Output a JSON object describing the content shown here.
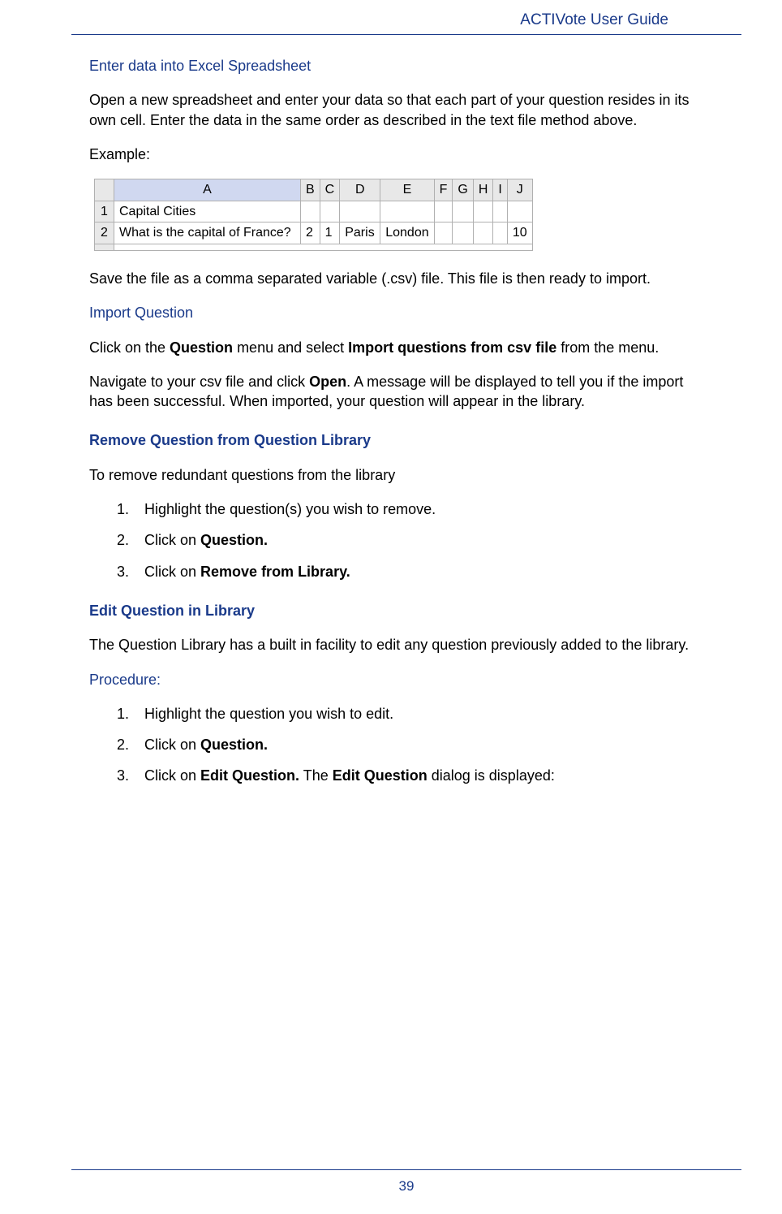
{
  "header": {
    "title": "ACTIVote User Guide"
  },
  "section1": {
    "heading": "Enter data into Excel Spreadsheet",
    "p1": "Open a new spreadsheet and enter your data so that each part of your question resides in its own cell. Enter the data in the same order as described in the text file method above.",
    "p2": "Example:"
  },
  "spreadsheet": {
    "cols": [
      "A",
      "B",
      "C",
      "D",
      "E",
      "F",
      "G",
      "H",
      "I",
      "J"
    ],
    "rows": [
      {
        "num": "1",
        "cells": [
          "Capital Cities",
          "",
          "",
          "",
          "",
          "",
          "",
          "",
          "",
          ""
        ]
      },
      {
        "num": "2",
        "cells": [
          "What is the capital of France?",
          "2",
          "1",
          "Paris",
          "London",
          "",
          "",
          "",
          "",
          "10"
        ]
      }
    ]
  },
  "section1b": {
    "p1": "Save the file as a comma separated variable (.csv) file. This file is then ready to import."
  },
  "section2": {
    "heading": "Import Question",
    "p1_pre": "Click on the ",
    "p1_b1": "Question",
    "p1_mid": " menu and select ",
    "p1_b2": "Import questions from csv file",
    "p1_post": " from the menu.",
    "p2_pre": "Navigate to your csv file and click ",
    "p2_b1": "Open",
    "p2_post": ". A message will be displayed to tell you if the import has been successful. When imported, your question will appear in the library."
  },
  "section3": {
    "heading": "Remove Question from Question Library",
    "p1": "To remove redundant questions from the library",
    "items": {
      "i1": {
        "num": "1.",
        "text": "Highlight the question(s) you wish to remove."
      },
      "i2": {
        "num": "2.",
        "pre": "Click on ",
        "b": "Question."
      },
      "i3": {
        "num": "3.",
        "pre": "Click on ",
        "b": "Remove from Library."
      }
    }
  },
  "section4": {
    "heading": "Edit Question in Library",
    "p1": "The Question Library has a built in facility to edit any question previously added to the library.",
    "sub": "Procedure:",
    "items": {
      "i1": {
        "num": "1.",
        "text": "Highlight the question you wish to edit."
      },
      "i2": {
        "num": "2.",
        "pre": "Click on ",
        "b": "Question."
      },
      "i3": {
        "num": "3.",
        "pre": "Click on ",
        "b1": "Edit Question.",
        "mid": " The ",
        "b2": "Edit Question",
        "post": " dialog is displayed:"
      }
    }
  },
  "footer": {
    "page": "39"
  }
}
